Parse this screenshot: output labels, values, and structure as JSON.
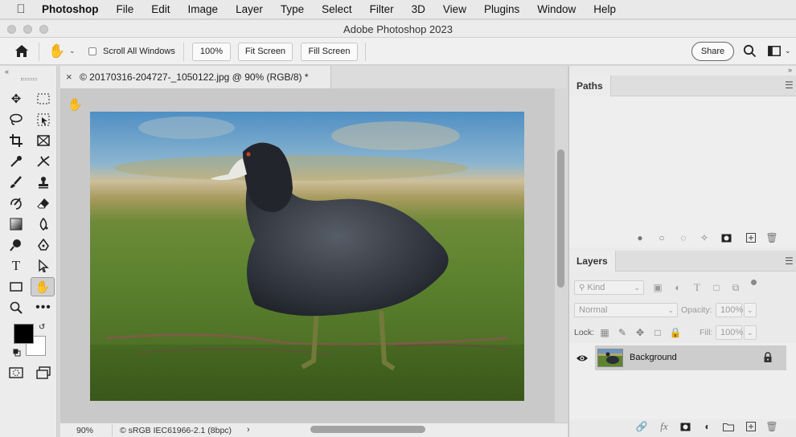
{
  "menubar": {
    "app": "Photoshop",
    "items": [
      "File",
      "Edit",
      "Image",
      "Layer",
      "Type",
      "Select",
      "Filter",
      "3D",
      "View",
      "Plugins",
      "Window",
      "Help"
    ]
  },
  "window": {
    "title": "Adobe Photoshop 2023"
  },
  "options": {
    "scroll_all_windows": "Scroll All Windows",
    "zoom_value": "100%",
    "fit_screen": "Fit Screen",
    "fill_screen": "Fill Screen",
    "share": "Share"
  },
  "document": {
    "tab_title": "© 20170316-204727-_1050122.jpg @ 90% (RGB/8) *",
    "zoom": "90%",
    "profile": "© sRGB IEC61966-2.1 (8bpc)"
  },
  "colors": {
    "foreground": "#000000",
    "background": "#ffffff"
  },
  "paths_panel": {
    "tab": "Paths"
  },
  "layers_panel": {
    "tab": "Layers",
    "filter_kind": "Kind",
    "blend_mode": "Normal",
    "opacity_label": "Opacity:",
    "opacity_value": "100%",
    "lock_label": "Lock:",
    "fill_label": "Fill:",
    "fill_value": "100%",
    "layers": [
      {
        "name": "Background",
        "locked": true,
        "visible": true
      }
    ]
  }
}
